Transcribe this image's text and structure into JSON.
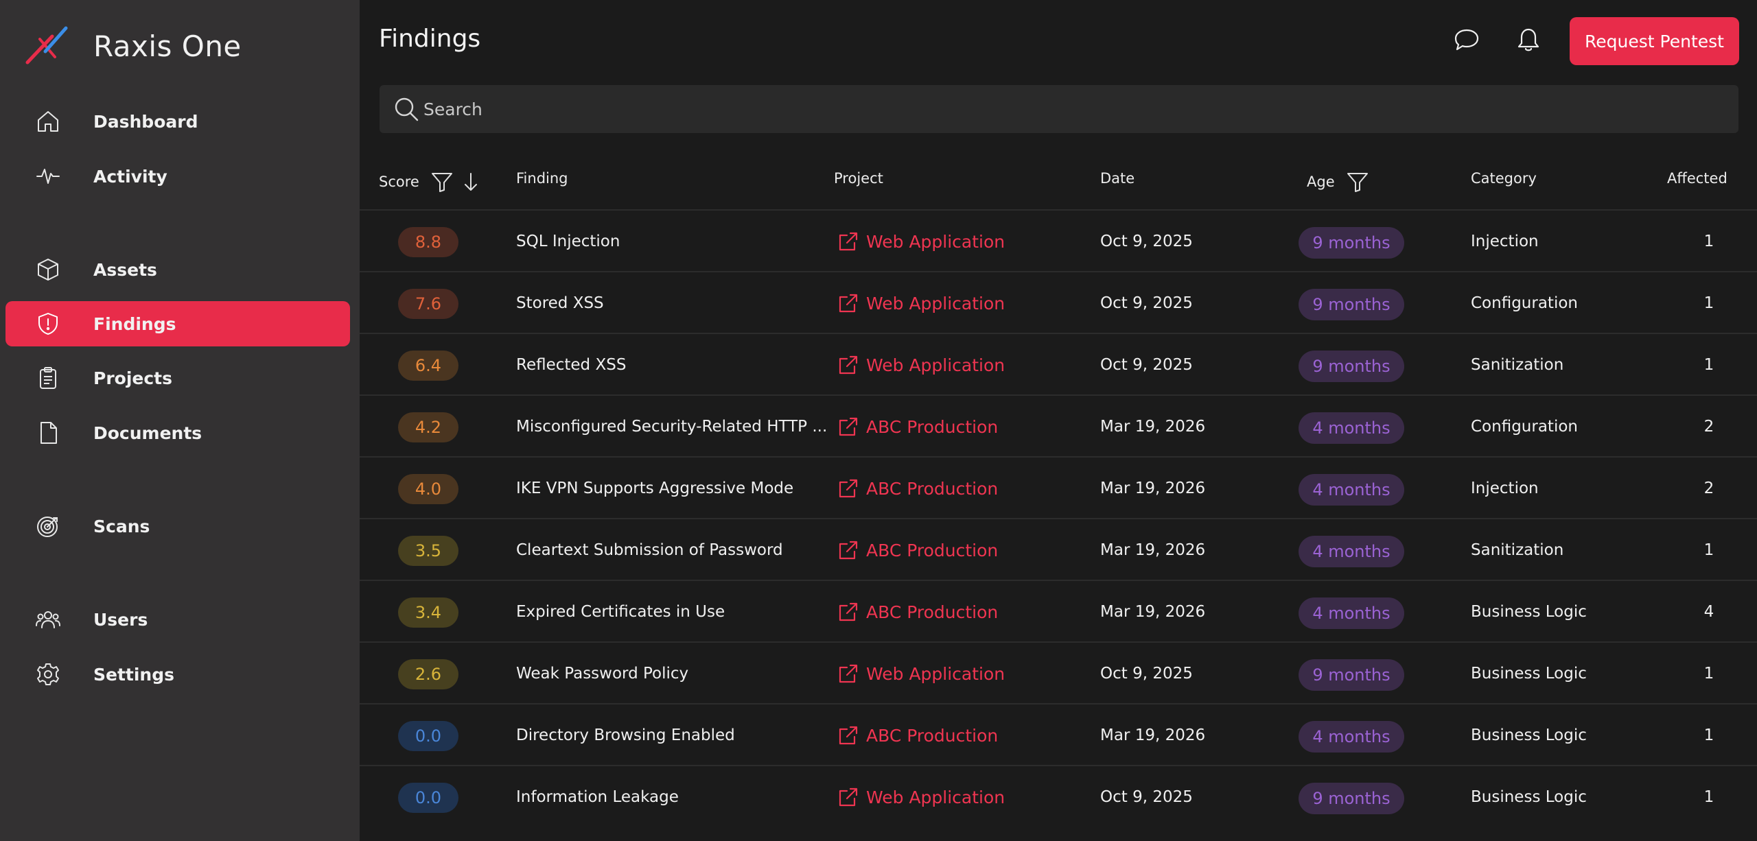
{
  "app": {
    "name": "Raxis One"
  },
  "sidebar": {
    "items": [
      {
        "label": "Dashboard",
        "icon": "home-icon"
      },
      {
        "label": "Activity",
        "icon": "activity-icon"
      },
      {
        "label": "Assets",
        "icon": "cube-icon"
      },
      {
        "label": "Findings",
        "icon": "shield-alert-icon",
        "active": true
      },
      {
        "label": "Projects",
        "icon": "clipboard-icon"
      },
      {
        "label": "Documents",
        "icon": "document-icon"
      },
      {
        "label": "Scans",
        "icon": "target-icon"
      },
      {
        "label": "Users",
        "icon": "users-icon"
      },
      {
        "label": "Settings",
        "icon": "gear-icon"
      }
    ]
  },
  "header": {
    "title": "Findings",
    "request_button": "Request Pentest",
    "icons": [
      "chat-icon",
      "bell-icon"
    ]
  },
  "search": {
    "placeholder": "Search"
  },
  "table": {
    "columns": {
      "score": "Score",
      "finding": "Finding",
      "project": "Project",
      "date": "Date",
      "age": "Age",
      "category": "Category",
      "affected": "Affected"
    },
    "rows": [
      {
        "score": "8.8",
        "finding": "SQL Injection",
        "project": "Web Application",
        "date": "Oct 9, 2025",
        "age": "9 months",
        "category": "Injection",
        "affected": "1"
      },
      {
        "score": "7.6",
        "finding": "Stored XSS",
        "project": "Web Application",
        "date": "Oct 9, 2025",
        "age": "9 months",
        "category": "Configuration",
        "affected": "1"
      },
      {
        "score": "6.4",
        "finding": "Reflected XSS",
        "project": "Web Application",
        "date": "Oct 9, 2025",
        "age": "9 months",
        "category": "Sanitization",
        "affected": "1"
      },
      {
        "score": "4.2",
        "finding": "Misconfigured Security-Related HTTP ...",
        "project": "ABC Production",
        "date": "Mar 19, 2026",
        "age": "4 months",
        "category": "Configuration",
        "affected": "2"
      },
      {
        "score": "4.0",
        "finding": "IKE VPN Supports Aggressive Mode",
        "project": "ABC Production",
        "date": "Mar 19, 2026",
        "age": "4 months",
        "category": "Injection",
        "affected": "2"
      },
      {
        "score": "3.5",
        "finding": "Cleartext Submission of Password",
        "project": "ABC Production",
        "date": "Mar 19, 2026",
        "age": "4 months",
        "category": "Sanitization",
        "affected": "1"
      },
      {
        "score": "3.4",
        "finding": "Expired Certificates in Use",
        "project": "ABC Production",
        "date": "Mar 19, 2026",
        "age": "4 months",
        "category": "Business Logic",
        "affected": "4"
      },
      {
        "score": "2.6",
        "finding": "Weak Password Policy",
        "project": "Web Application",
        "date": "Oct 9, 2025",
        "age": "9 months",
        "category": "Business Logic",
        "affected": "1"
      },
      {
        "score": "0.0",
        "finding": "Directory Browsing Enabled",
        "project": "ABC Production",
        "date": "Mar 19, 2026",
        "age": "4 months",
        "category": "Business Logic",
        "affected": "1"
      },
      {
        "score": "0.0",
        "finding": "Information Leakage",
        "project": "Web Application",
        "date": "Oct 9, 2025",
        "age": "9 months",
        "category": "Business Logic",
        "affected": "1"
      }
    ]
  },
  "colors": {
    "accent": "#e82c4a",
    "score_high_bg": "#4a2a22",
    "score_high_fg": "#e0613a",
    "score_med_bg": "#4a3520",
    "score_med_fg": "#e8893a",
    "score_low_bg": "#47401f",
    "score_low_fg": "#d8b43a",
    "score_none_bg": "#1f3350",
    "score_none_fg": "#4a86d8",
    "age_bg": "#3a2b48",
    "age_fg": "#9b63d4"
  }
}
